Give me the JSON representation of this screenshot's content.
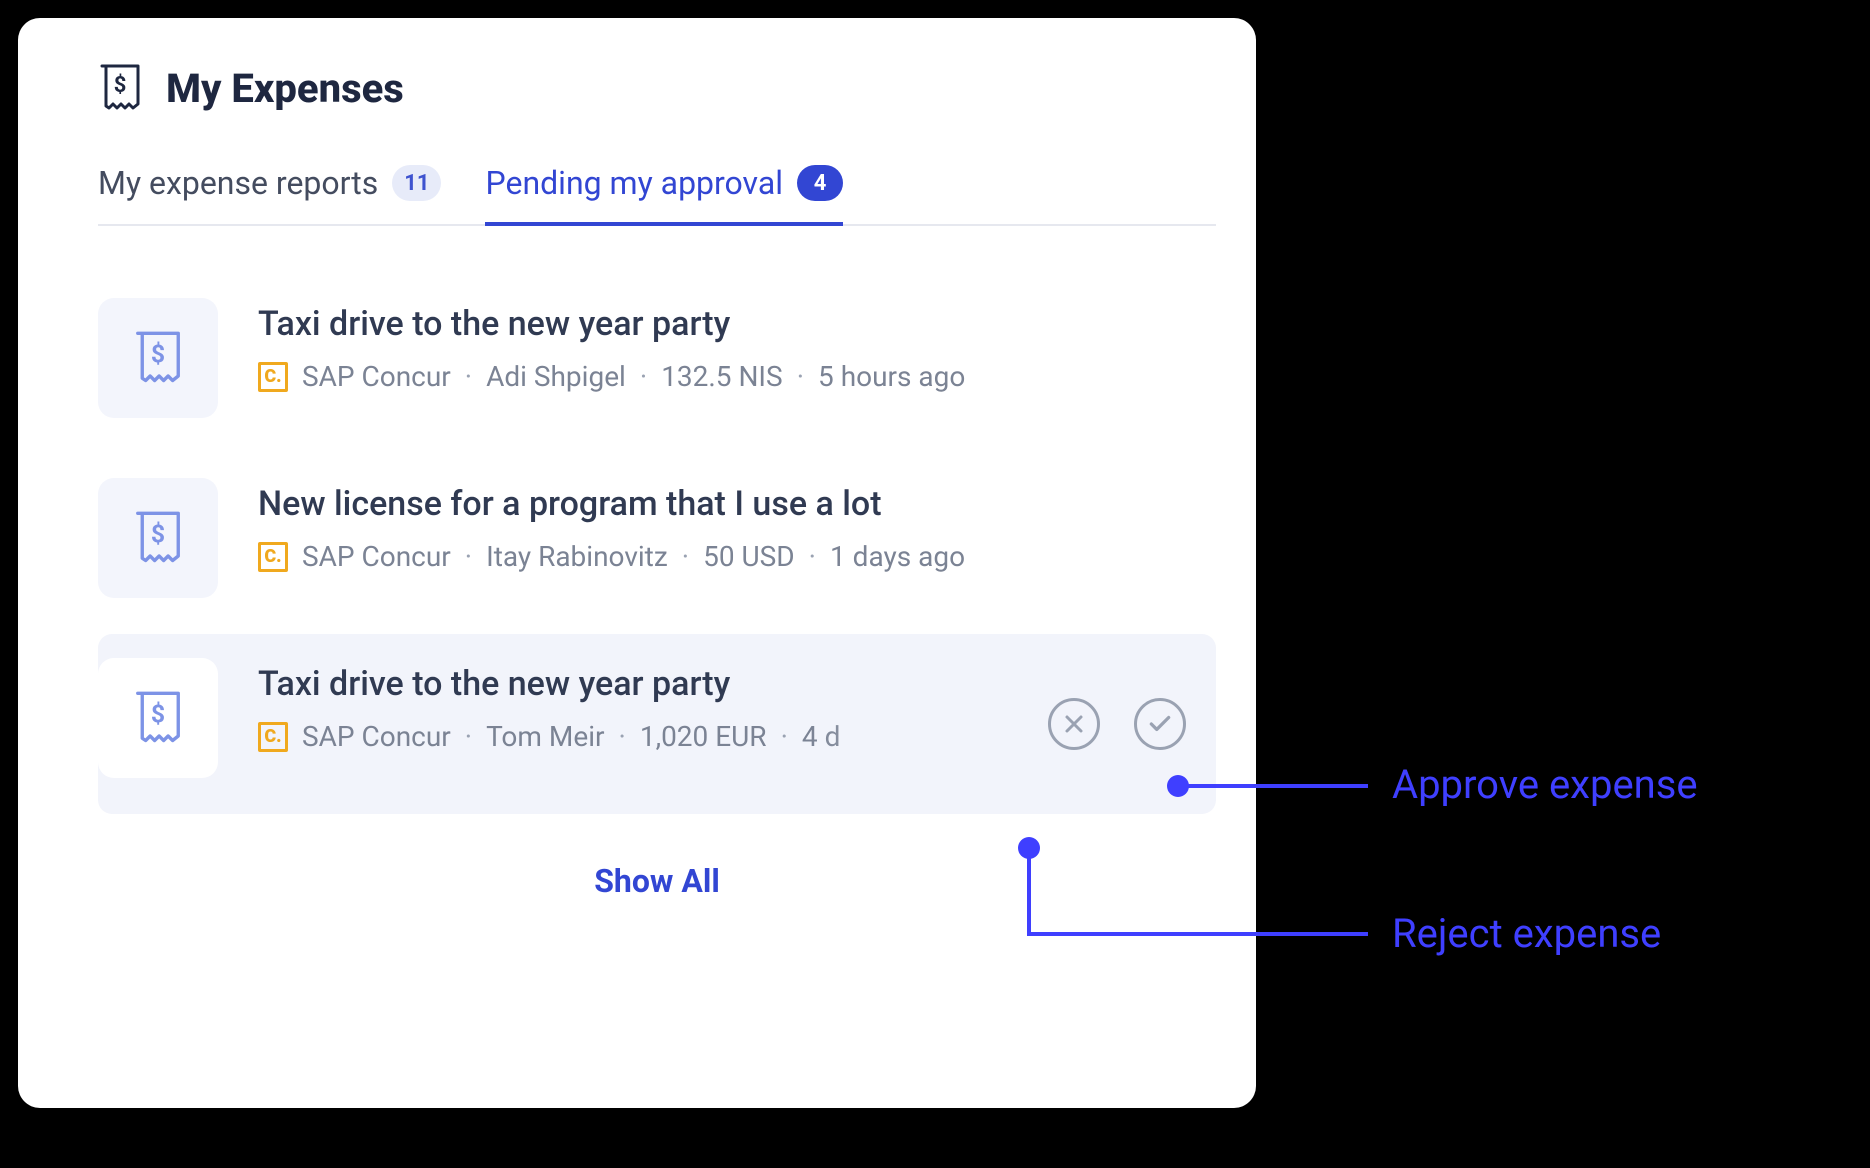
{
  "header": {
    "title": "My Expenses"
  },
  "tabs": {
    "reports": {
      "label": "My expense reports",
      "count": "11"
    },
    "pending": {
      "label": "Pending my approval",
      "count": "4"
    }
  },
  "items": [
    {
      "title": "Taxi drive to the new year party",
      "source": "SAP Concur",
      "person": "Adi Shpigel",
      "amount": "132.5 NIS",
      "age": "5 hours ago"
    },
    {
      "title": "New license for a program that I use a lot",
      "source": "SAP Concur",
      "person": "Itay Rabinovitz",
      "amount": "50 USD",
      "age": "1 days ago"
    },
    {
      "title": "Taxi drive to the new year party",
      "source": "SAP Concur",
      "person": "Tom Meir",
      "amount": "1,020 EUR",
      "age": "4 d"
    }
  ],
  "concur_glyph": "C.",
  "show_all": "Show All",
  "annotations": {
    "approve": "Approve expense",
    "reject": "Reject expense"
  },
  "dot": "·"
}
